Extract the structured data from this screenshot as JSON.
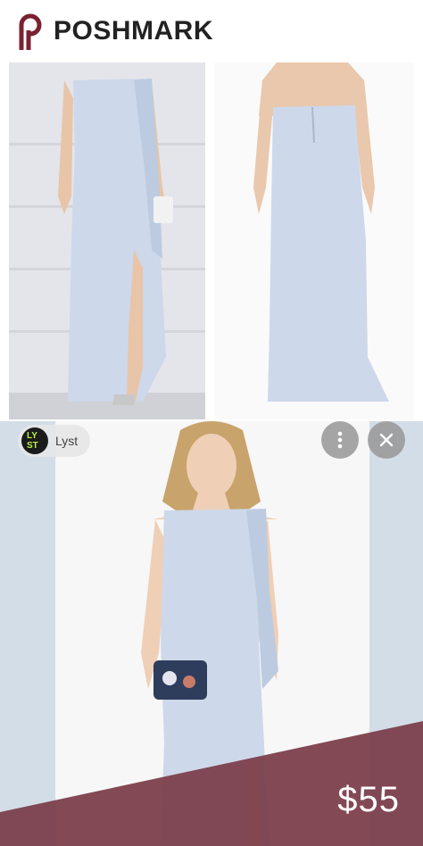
{
  "header": {
    "brand": "POSHMARK"
  },
  "source": {
    "name": "Lyst",
    "logo_line1": "LY",
    "logo_line2": "ST"
  },
  "actions": {
    "more_icon": "more-vertical-icon",
    "close_icon": "close-icon"
  },
  "listing": {
    "price": "$55"
  },
  "colors": {
    "banner": "#7a3c48",
    "dress": "#cdd8ea",
    "brand_mark": "#7a2231"
  }
}
